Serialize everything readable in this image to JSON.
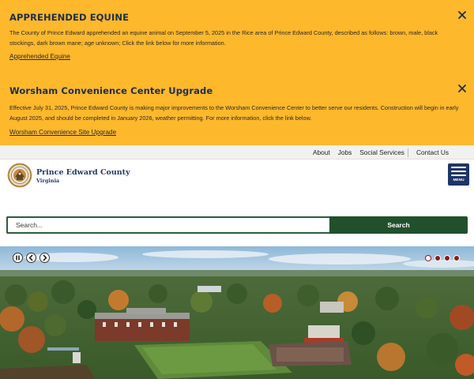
{
  "alerts": [
    {
      "title": "APPREHENDED EQUINE",
      "body": "The County of Prince Edward apprehended an equine animal on September 5, 2025 in the Rice area of Prince Edward County, described as follows: brown, male, black stockings, dark brown mane; age unknown; Click the link below for more information.",
      "link": "Apprehended Equine"
    },
    {
      "title": "Worsham Convenience Center Upgrade",
      "body": "Effective July 31, 2025, Prince Edward County is making major improvements to the Worsham Convenience Center to better serve our residents. Construction will begin in early August 2025, and should be completed in January 2026, weather permitting. For more information, click the link below.",
      "link": "Worsham Convenience Site Upgrade"
    }
  ],
  "utility_nav": [
    "About",
    "Jobs",
    "Social Services",
    "Contact Us"
  ],
  "header": {
    "name": "Prince Edward County",
    "subtitle": "Virginia",
    "menu_label": "MENU"
  },
  "search": {
    "placeholder": "Search...",
    "button_label": "Search"
  },
  "slideshow": {
    "slide_count": 4,
    "active_slide": 1
  },
  "colors": {
    "alert_bg": "#fdb82c",
    "brand_navy": "#1f3567",
    "search_green": "#22502d"
  }
}
